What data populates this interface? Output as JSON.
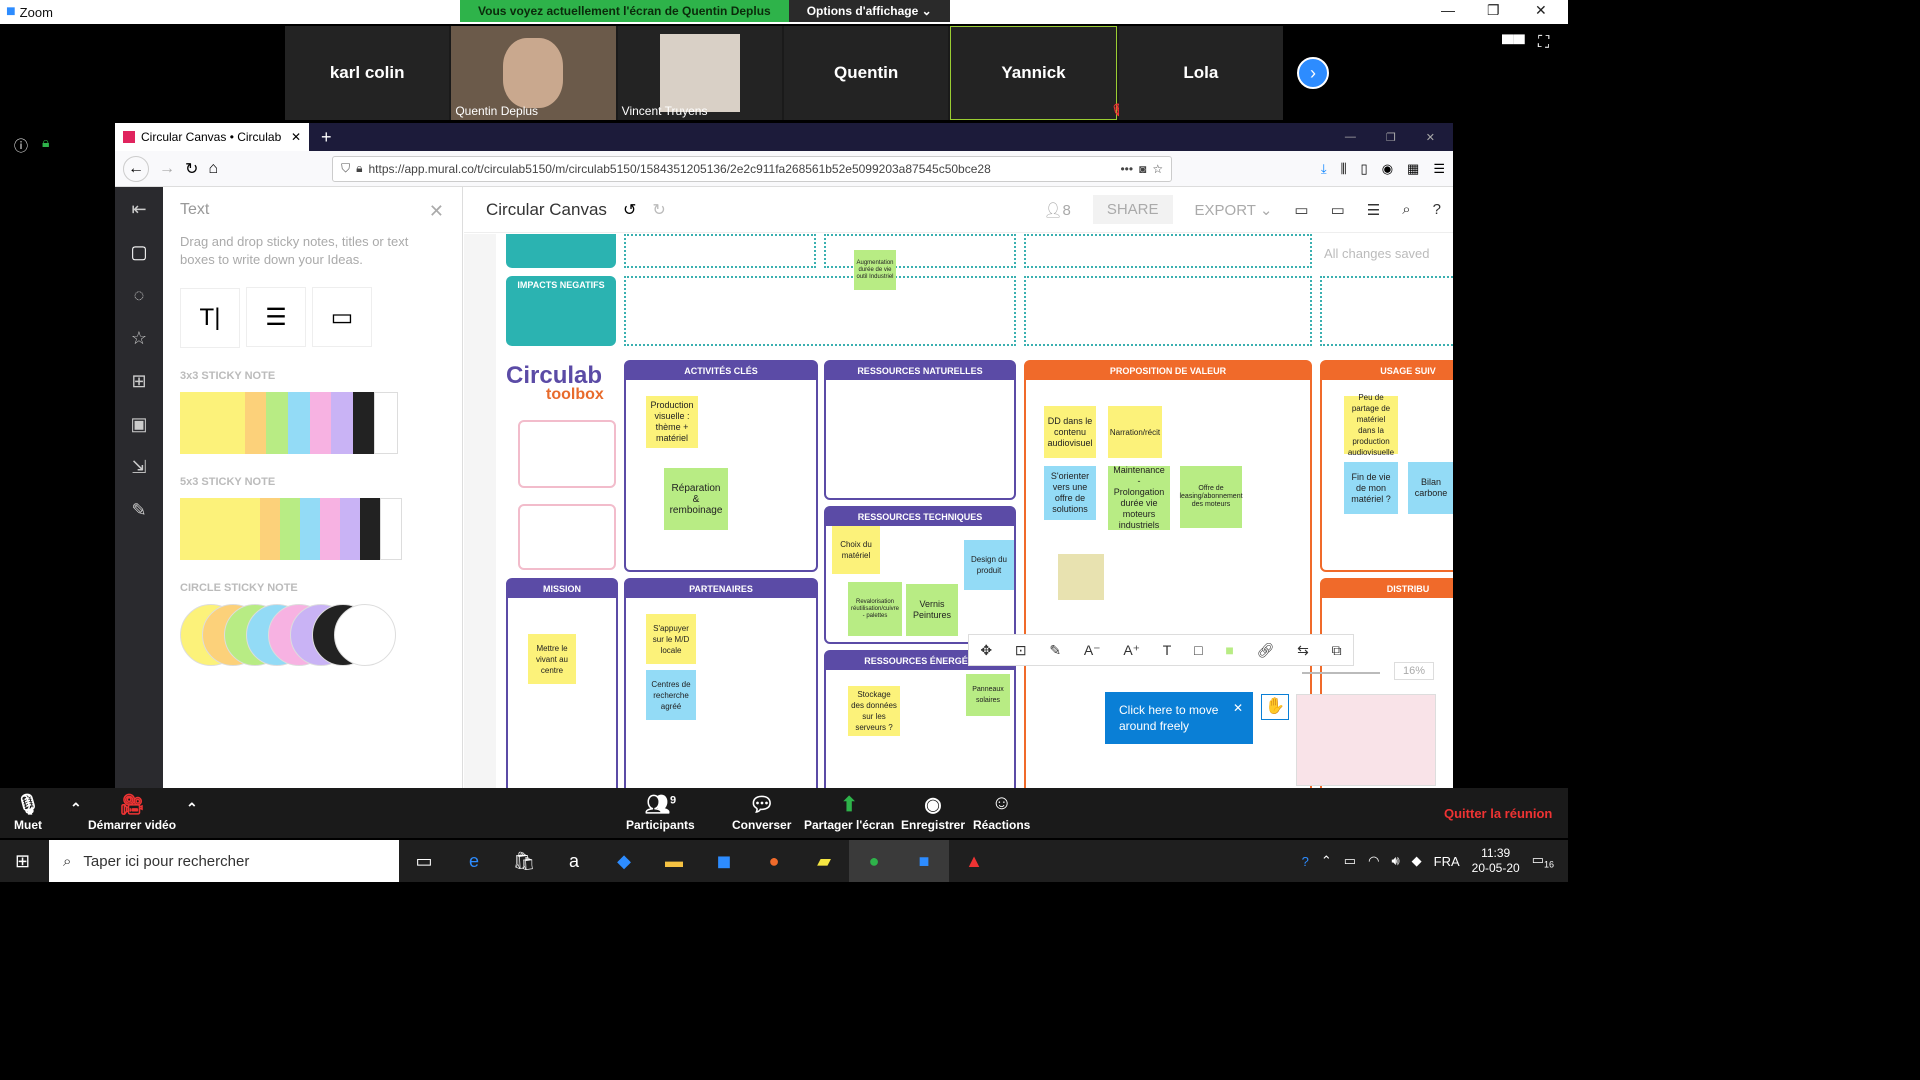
{
  "zoom": {
    "app_title": "Zoom",
    "banner_text": "Vous voyez actuellement l'écran de Quentin Deplus",
    "view_options": "Options d'affichage",
    "participants": [
      {
        "name": "karl  colin",
        "video": false
      },
      {
        "name": "Quentin Deplus",
        "video": true
      },
      {
        "name": "Vincent Truyens",
        "video": true
      },
      {
        "name": "Quentin",
        "video": false
      },
      {
        "name": "Yannick",
        "video": false
      },
      {
        "name": "Lola",
        "video": false
      }
    ],
    "controls": {
      "mute": "Muet",
      "video": "Démarrer vidéo",
      "participants": "Participants",
      "participants_count": "9",
      "chat": "Converser",
      "share": "Partager l'écran",
      "record": "Enregistrer",
      "reactions": "Réactions",
      "leave": "Quitter la réunion"
    }
  },
  "browser": {
    "tab_title": "Circular Canvas • Circulab",
    "url": "https://app.mural.co/t/circulab5150/m/circulab5150/1584351205136/2e2c911fa268561b52e5099203a87545c50bce28"
  },
  "mural": {
    "board_title": "Circular Canvas",
    "user_count": "8",
    "share": "SHARE",
    "export": "EXPORT",
    "saved": "All changes saved",
    "panel": {
      "title": "Text",
      "desc": "Drag and drop sticky notes, titles or text boxes to write down your Ideas.",
      "sec1": "3x3 STICKY NOTE",
      "sec2": "5x3 STICKY NOTE",
      "sec3": "CIRCLE STICKY NOTE"
    },
    "zoom_level": "16%",
    "tip": "Click here to move around freely",
    "sections": {
      "impacts": "IMPACTS NEGATIFS",
      "activites": "ACTIVITÉS CLÉS",
      "ressources_nat": "RESSOURCES  NATURELLES",
      "proposition": "PROPOSITION DE VALEUR",
      "usage": "USAGE SUIV",
      "ressources_tech": "RESSOURCES TECHNIQUES",
      "ressources_en": "RESSOURCES ÉNERGÉTI",
      "mission": "MISSION",
      "partenaires": "PARTENAIRES",
      "distrib": "DISTRIBU",
      "logo1": "Circulab",
      "logo2": "toolbox"
    },
    "stickies": {
      "s1": "Augmentation durée de vie outil Industriel",
      "s2": "Production visuelle : thème + matériel",
      "s3": "Réparation & remboinage",
      "s4": "DD dans le contenu audiovisuel",
      "s5": "Narration/récit",
      "s6": "S'orienter vers une offre de solutions",
      "s7": "Maintenance - Prolongation durée vie moteurs industriels",
      "s8": "Offre de leasing/abonnement des moteurs",
      "s9": "Peu de partage de matériel dans la production audiovisuelle",
      "s10": "Fin de vie de mon matériel ?",
      "s11": "Bilan carbone",
      "s12": "Choix du matériel",
      "s13": "Design du produit",
      "s14": "Revalorisation réutilisation/cuivre - palettes",
      "s15": "Vernis Peintures",
      "s16": "Mettre le vivant au centre",
      "s17": "S'appuyer sur le M/D locale",
      "s18": "Centres de recherche agréé",
      "s19": "Stockage des données sur les serveurs ?",
      "s20": "Panneaux solaires"
    }
  },
  "taskbar": {
    "search": "Taper ici pour rechercher",
    "time": "11:39",
    "date": "20-05-20",
    "lang": "FRA",
    "notif": "16"
  }
}
